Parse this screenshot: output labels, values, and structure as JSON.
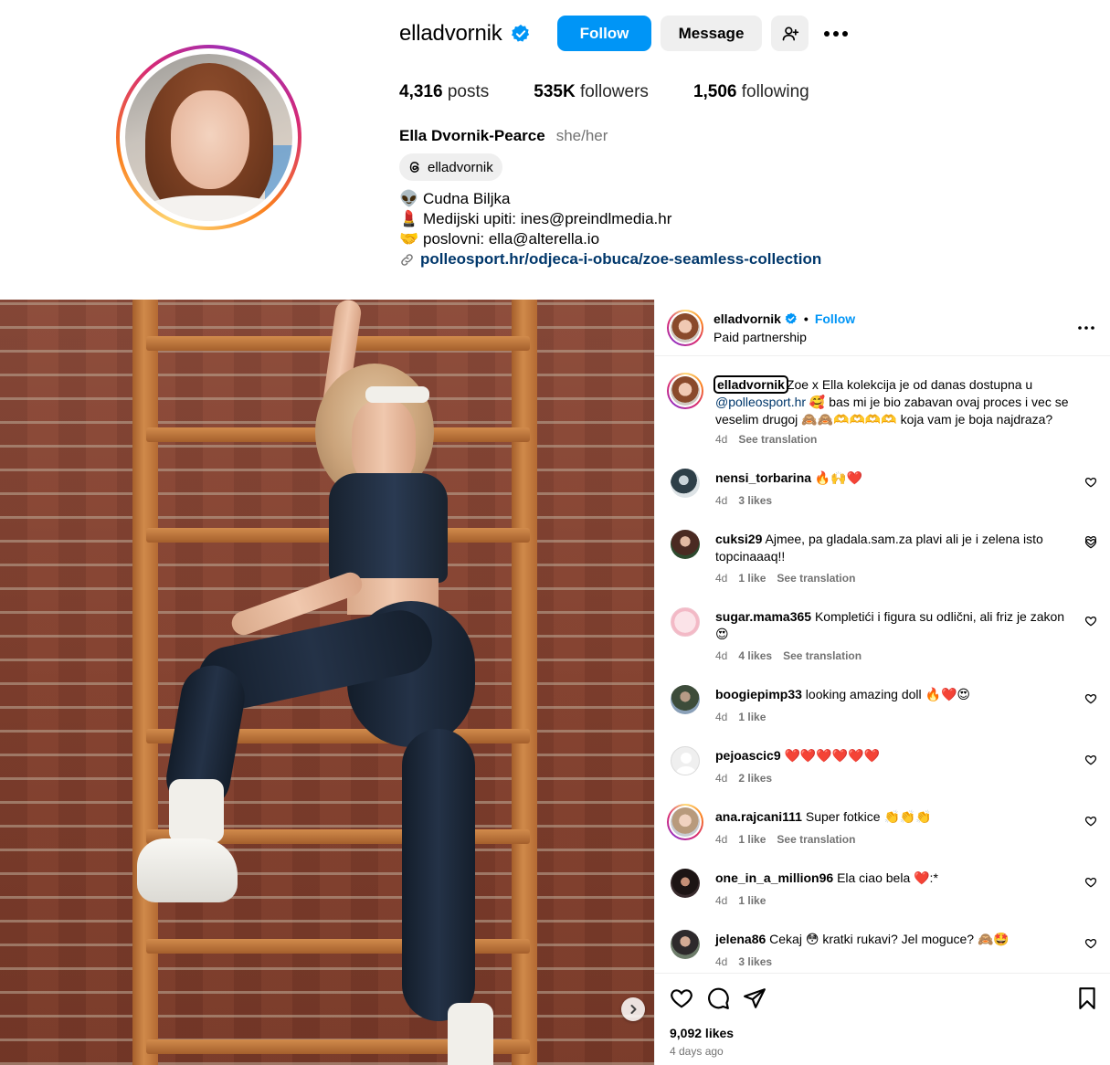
{
  "profile": {
    "username": "elladvornik",
    "verified_icon": "verified-badge-icon",
    "follow_label": "Follow",
    "message_label": "Message",
    "add_user_icon": "add-user-icon",
    "more_icon": "more-options-icon",
    "stats": [
      {
        "value": "4,316",
        "label": "posts"
      },
      {
        "value": "535K",
        "label": "followers"
      },
      {
        "value": "1,506",
        "label": "following"
      }
    ],
    "full_name": "Ella Dvornik-Pearce",
    "pronouns": "she/her",
    "threads_handle": "elladvornik",
    "bio": [
      {
        "emoji": "👽",
        "text": "Cudna Biljka"
      },
      {
        "emoji": "💄",
        "text": "Medijski upiti: ines@preindlmedia.hr"
      },
      {
        "emoji": "🤝",
        "text": "poslovni: ella@alterella.io"
      }
    ],
    "link": "polleosport.hr/odjeca-i-obuca/zoe-seamless-collection"
  },
  "post": {
    "author": "elladvornik",
    "follow_label": "Follow",
    "dot": "•",
    "subtitle": "Paid partnership",
    "caption": {
      "user": "elladvornik",
      "text_a": "Zoe x Ella kolekcija je od danas dostupna u ",
      "mention": "@polleosport.hr",
      "text_b": " 🥰 bas mi je bio zabavan ovaj proces i vec se veselim drugoj 🙈🙈🫶🫶🫶🫶 koja vam je boja najdraza?",
      "time": "4d",
      "see_translation": "See translation"
    },
    "comments": [
      {
        "user": "nensi_torbarina",
        "text": "🔥🙌❤️",
        "time": "4d",
        "likes": "3 likes",
        "translation": ""
      },
      {
        "user": "cuksi29",
        "text": "Ajmee, pa gladala.sam.za plavi ali je i zelena isto topcinaaaq!!",
        "time": "4d",
        "likes": "1 like",
        "translation": "See translation"
      },
      {
        "user": "sugar.mama365",
        "text": "Kompletići i figura su odlični, ali friz je zakon 😍",
        "time": "4d",
        "likes": "4 likes",
        "translation": "See translation"
      },
      {
        "user": "boogiepimp33",
        "text": "looking amazing doll 🔥❤️😍",
        "time": "4d",
        "likes": "1 like",
        "translation": ""
      },
      {
        "user": "pejoascic9",
        "text": "❤️❤️❤️❤️❤️❤️",
        "time": "4d",
        "likes": "2 likes",
        "translation": ""
      },
      {
        "user": "ana.rajcani111",
        "text": "Super fotkice 👏👏👏",
        "time": "4d",
        "likes": "1 like",
        "translation": "See translation"
      },
      {
        "user": "one_in_a_million96",
        "text": "Ela ciao bela ❤️:*",
        "time": "4d",
        "likes": "1 like",
        "translation": ""
      },
      {
        "user": "jelena86",
        "text": "Cekaj 😳 kratki rukavi? Jel moguce? 🙈🤩",
        "time": "4d",
        "likes": "3 likes",
        "translation": ""
      }
    ],
    "likes": "9,092 likes",
    "time_ago": "4 days ago"
  },
  "colors": {
    "accent": "#0095f6",
    "link": "#00376b",
    "muted": "#737373",
    "button_gray": "#efefef"
  }
}
